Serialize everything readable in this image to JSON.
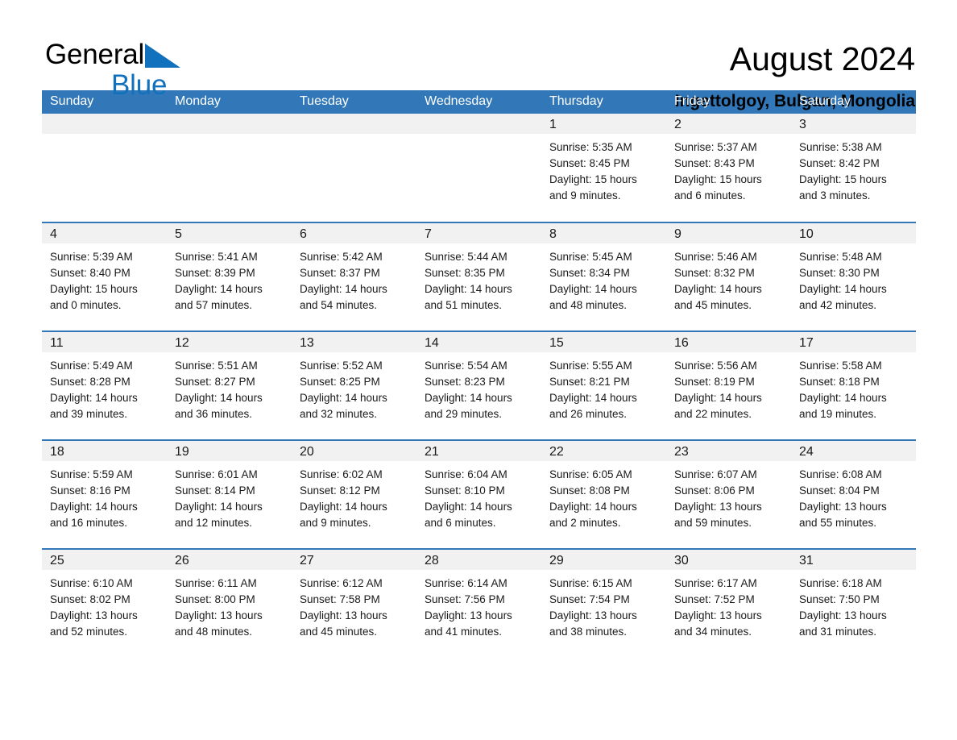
{
  "brand": {
    "name_part1": "General",
    "name_part2": "Blue",
    "triangle_icon": "blue-triangle-icon",
    "accent_color": "#1271bd"
  },
  "header": {
    "title": "August 2024",
    "subtitle": "Ingettolgoy, Bulgan, Mongolia"
  },
  "theme": {
    "header_blue": "#3278b8",
    "band_gray": "#f1f1f1",
    "text_color": "#1a1a1a"
  },
  "calendar": {
    "weekday_headers": [
      "Sunday",
      "Monday",
      "Tuesday",
      "Wednesday",
      "Thursday",
      "Friday",
      "Saturday"
    ],
    "weeks": [
      [
        {
          "day": "",
          "lines": []
        },
        {
          "day": "",
          "lines": []
        },
        {
          "day": "",
          "lines": []
        },
        {
          "day": "",
          "lines": []
        },
        {
          "day": "1",
          "lines": [
            "Sunrise: 5:35 AM",
            "Sunset: 8:45 PM",
            "Daylight: 15 hours",
            "and 9 minutes."
          ]
        },
        {
          "day": "2",
          "lines": [
            "Sunrise: 5:37 AM",
            "Sunset: 8:43 PM",
            "Daylight: 15 hours",
            "and 6 minutes."
          ]
        },
        {
          "day": "3",
          "lines": [
            "Sunrise: 5:38 AM",
            "Sunset: 8:42 PM",
            "Daylight: 15 hours",
            "and 3 minutes."
          ]
        }
      ],
      [
        {
          "day": "4",
          "lines": [
            "Sunrise: 5:39 AM",
            "Sunset: 8:40 PM",
            "Daylight: 15 hours",
            "and 0 minutes."
          ]
        },
        {
          "day": "5",
          "lines": [
            "Sunrise: 5:41 AM",
            "Sunset: 8:39 PM",
            "Daylight: 14 hours",
            "and 57 minutes."
          ]
        },
        {
          "day": "6",
          "lines": [
            "Sunrise: 5:42 AM",
            "Sunset: 8:37 PM",
            "Daylight: 14 hours",
            "and 54 minutes."
          ]
        },
        {
          "day": "7",
          "lines": [
            "Sunrise: 5:44 AM",
            "Sunset: 8:35 PM",
            "Daylight: 14 hours",
            "and 51 minutes."
          ]
        },
        {
          "day": "8",
          "lines": [
            "Sunrise: 5:45 AM",
            "Sunset: 8:34 PM",
            "Daylight: 14 hours",
            "and 48 minutes."
          ]
        },
        {
          "day": "9",
          "lines": [
            "Sunrise: 5:46 AM",
            "Sunset: 8:32 PM",
            "Daylight: 14 hours",
            "and 45 minutes."
          ]
        },
        {
          "day": "10",
          "lines": [
            "Sunrise: 5:48 AM",
            "Sunset: 8:30 PM",
            "Daylight: 14 hours",
            "and 42 minutes."
          ]
        }
      ],
      [
        {
          "day": "11",
          "lines": [
            "Sunrise: 5:49 AM",
            "Sunset: 8:28 PM",
            "Daylight: 14 hours",
            "and 39 minutes."
          ]
        },
        {
          "day": "12",
          "lines": [
            "Sunrise: 5:51 AM",
            "Sunset: 8:27 PM",
            "Daylight: 14 hours",
            "and 36 minutes."
          ]
        },
        {
          "day": "13",
          "lines": [
            "Sunrise: 5:52 AM",
            "Sunset: 8:25 PM",
            "Daylight: 14 hours",
            "and 32 minutes."
          ]
        },
        {
          "day": "14",
          "lines": [
            "Sunrise: 5:54 AM",
            "Sunset: 8:23 PM",
            "Daylight: 14 hours",
            "and 29 minutes."
          ]
        },
        {
          "day": "15",
          "lines": [
            "Sunrise: 5:55 AM",
            "Sunset: 8:21 PM",
            "Daylight: 14 hours",
            "and 26 minutes."
          ]
        },
        {
          "day": "16",
          "lines": [
            "Sunrise: 5:56 AM",
            "Sunset: 8:19 PM",
            "Daylight: 14 hours",
            "and 22 minutes."
          ]
        },
        {
          "day": "17",
          "lines": [
            "Sunrise: 5:58 AM",
            "Sunset: 8:18 PM",
            "Daylight: 14 hours",
            "and 19 minutes."
          ]
        }
      ],
      [
        {
          "day": "18",
          "lines": [
            "Sunrise: 5:59 AM",
            "Sunset: 8:16 PM",
            "Daylight: 14 hours",
            "and 16 minutes."
          ]
        },
        {
          "day": "19",
          "lines": [
            "Sunrise: 6:01 AM",
            "Sunset: 8:14 PM",
            "Daylight: 14 hours",
            "and 12 minutes."
          ]
        },
        {
          "day": "20",
          "lines": [
            "Sunrise: 6:02 AM",
            "Sunset: 8:12 PM",
            "Daylight: 14 hours",
            "and 9 minutes."
          ]
        },
        {
          "day": "21",
          "lines": [
            "Sunrise: 6:04 AM",
            "Sunset: 8:10 PM",
            "Daylight: 14 hours",
            "and 6 minutes."
          ]
        },
        {
          "day": "22",
          "lines": [
            "Sunrise: 6:05 AM",
            "Sunset: 8:08 PM",
            "Daylight: 14 hours",
            "and 2 minutes."
          ]
        },
        {
          "day": "23",
          "lines": [
            "Sunrise: 6:07 AM",
            "Sunset: 8:06 PM",
            "Daylight: 13 hours",
            "and 59 minutes."
          ]
        },
        {
          "day": "24",
          "lines": [
            "Sunrise: 6:08 AM",
            "Sunset: 8:04 PM",
            "Daylight: 13 hours",
            "and 55 minutes."
          ]
        }
      ],
      [
        {
          "day": "25",
          "lines": [
            "Sunrise: 6:10 AM",
            "Sunset: 8:02 PM",
            "Daylight: 13 hours",
            "and 52 minutes."
          ]
        },
        {
          "day": "26",
          "lines": [
            "Sunrise: 6:11 AM",
            "Sunset: 8:00 PM",
            "Daylight: 13 hours",
            "and 48 minutes."
          ]
        },
        {
          "day": "27",
          "lines": [
            "Sunrise: 6:12 AM",
            "Sunset: 7:58 PM",
            "Daylight: 13 hours",
            "and 45 minutes."
          ]
        },
        {
          "day": "28",
          "lines": [
            "Sunrise: 6:14 AM",
            "Sunset: 7:56 PM",
            "Daylight: 13 hours",
            "and 41 minutes."
          ]
        },
        {
          "day": "29",
          "lines": [
            "Sunrise: 6:15 AM",
            "Sunset: 7:54 PM",
            "Daylight: 13 hours",
            "and 38 minutes."
          ]
        },
        {
          "day": "30",
          "lines": [
            "Sunrise: 6:17 AM",
            "Sunset: 7:52 PM",
            "Daylight: 13 hours",
            "and 34 minutes."
          ]
        },
        {
          "day": "31",
          "lines": [
            "Sunrise: 6:18 AM",
            "Sunset: 7:50 PM",
            "Daylight: 13 hours",
            "and 31 minutes."
          ]
        }
      ]
    ]
  }
}
